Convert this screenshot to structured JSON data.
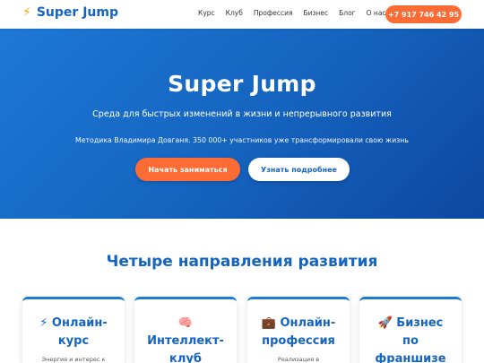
{
  "header": {
    "logo_icon": "⚡",
    "logo_text": "Super Jump",
    "nav": [
      "Курс",
      "Клуб",
      "Профессия",
      "Бизнес",
      "Блог",
      "О нас"
    ],
    "phone": "+7 917 746 42 95"
  },
  "hero": {
    "title": "Super Jump",
    "subtitle": "Среда для быстрых изменений в жизни и непрерывного развития",
    "description": "Методика Владимира Довганя. 350 000+ участников уже трансформировали свою жизнь",
    "primary_button": "Начать заниматься",
    "secondary_button": "Узнать подробнее"
  },
  "directions": {
    "title": "Четыре направления развития",
    "cards": [
      {
        "icon": "⚡",
        "title": "⚡ Онлайн-курс",
        "text": "Энергия и интерес к"
      },
      {
        "icon": "🧠",
        "title": "🧠 Интеллект-клуб",
        "text": ""
      },
      {
        "icon": "💼",
        "title": "💼 Онлайн-профессия",
        "text": "Реализация в"
      },
      {
        "icon": "🚀",
        "title": "🚀 Бизнес по франшизе",
        "text": ""
      }
    ]
  },
  "colors": {
    "brand_blue": "#1565c0",
    "accent_orange": "#ff6b35"
  }
}
